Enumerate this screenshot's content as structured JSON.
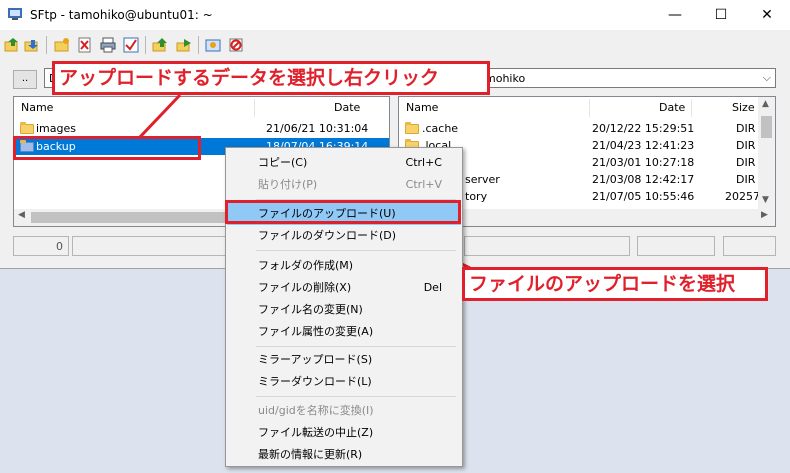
{
  "window": {
    "title": "SFtp - tamohiko@ubuntu01: ~"
  },
  "toolbar": {
    "icons": [
      "upload-icon",
      "download-icon",
      "new-folder-icon",
      "delete-icon",
      "print-icon",
      "check-icon",
      "move-up-icon",
      "move-right-icon",
      "settings-icon",
      "disconnect-icon"
    ]
  },
  "path_bar": {
    "up_label": "..",
    "left_path": "D",
    "right_path": "mohiko"
  },
  "left_pane": {
    "columns": {
      "name": "Name",
      "date": "Date"
    },
    "rows": [
      {
        "name": "images",
        "date": "21/06/21 10:31:04"
      },
      {
        "name": "backup",
        "date": "18/07/04 16:39:14"
      }
    ]
  },
  "right_pane": {
    "columns": {
      "name": "Name",
      "date": "Date",
      "size": "Size"
    },
    "rows": [
      {
        "name": ".cache",
        "date": "20/12/22 15:29:51",
        "size": "DIR"
      },
      {
        "name": ".local",
        "date": "21/04/23 12:41:23",
        "size": "DIR"
      },
      {
        "name": "",
        "date": "21/03/01 10:27:18",
        "size": "DIR"
      },
      {
        "name": "server",
        "date": "21/03/08 12:42:17",
        "size": "DIR"
      },
      {
        "name": "tory",
        "date": "21/07/05 10:55:46",
        "size": "20257"
      }
    ]
  },
  "status": {
    "left_value": "0"
  },
  "context_menu": {
    "items": [
      {
        "label": "コピー(C)",
        "shortcut": "Ctrl+C",
        "disabled": false
      },
      {
        "label": "貼り付け(P)",
        "shortcut": "Ctrl+V",
        "disabled": true
      },
      {
        "label": "ファイルのアップロード(U)",
        "shortcut": "",
        "disabled": false
      },
      {
        "label": "ファイルのダウンロード(D)",
        "shortcut": "",
        "disabled": false
      },
      {
        "label": "フォルダの作成(M)",
        "shortcut": "",
        "disabled": false
      },
      {
        "label": "ファイルの削除(X)",
        "shortcut": "Del",
        "disabled": false
      },
      {
        "label": "ファイル名の変更(N)",
        "shortcut": "",
        "disabled": false
      },
      {
        "label": "ファイル属性の変更(A)",
        "shortcut": "",
        "disabled": false
      },
      {
        "label": "ミラーアップロード(S)",
        "shortcut": "",
        "disabled": false
      },
      {
        "label": "ミラーダウンロード(L)",
        "shortcut": "",
        "disabled": false
      },
      {
        "label": "uid/gidを名称に変換(I)",
        "shortcut": "",
        "disabled": true
      },
      {
        "label": "ファイル転送の中止(Z)",
        "shortcut": "",
        "disabled": false
      },
      {
        "label": "最新の情報に更新(R)",
        "shortcut": "",
        "disabled": false
      }
    ]
  },
  "annotations": {
    "select_data": "アップロードするデータを選択し右クリック",
    "select_upload": "ファイルのアップロードを選択"
  },
  "colors": {
    "accent_red": "#e0212b",
    "selection_blue": "#0078d7",
    "menu_highlight": "#90c8f6"
  }
}
